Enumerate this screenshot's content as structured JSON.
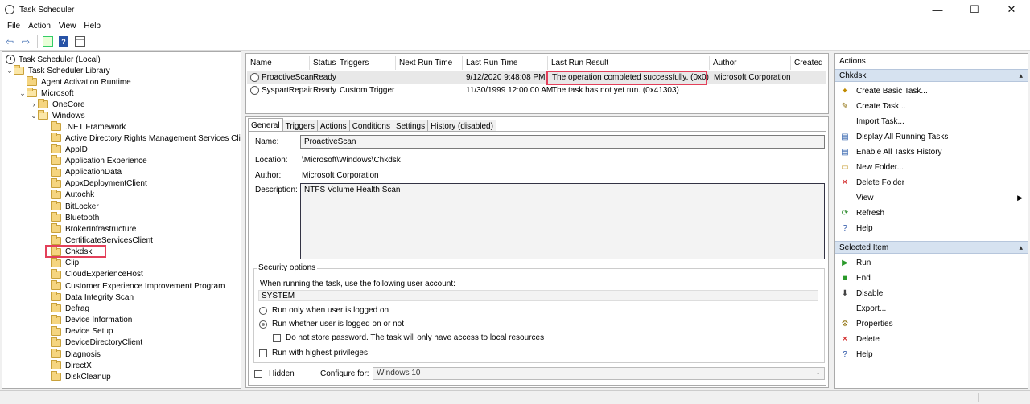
{
  "window": {
    "title": "Task Scheduler",
    "controls": {
      "minimize": "—",
      "maximize": "☐",
      "close": "✕"
    }
  },
  "menu": [
    "File",
    "Action",
    "View",
    "Help"
  ],
  "tree": {
    "root": "Task Scheduler (Local)",
    "library": "Task Scheduler Library",
    "agent": "Agent Activation Runtime",
    "microsoft": "Microsoft",
    "onecore": "OneCore",
    "windows": "Windows",
    "folders": [
      ".NET Framework",
      "Active Directory Rights Management Services Cli",
      "AppID",
      "Application Experience",
      "ApplicationData",
      "AppxDeploymentClient",
      "Autochk",
      "BitLocker",
      "Bluetooth",
      "BrokerInfrastructure",
      "CertificateServicesClient",
      "Chkdsk",
      "Clip",
      "CloudExperienceHost",
      "Customer Experience Improvement Program",
      "Data Integrity Scan",
      "Defrag",
      "Device Information",
      "Device Setup",
      "DeviceDirectoryClient",
      "Diagnosis",
      "DirectX",
      "DiskCleanup"
    ]
  },
  "tasks": {
    "columns": [
      "Name",
      "Status",
      "Triggers",
      "Next Run Time",
      "Last Run Time",
      "Last Run Result",
      "Author",
      "Created"
    ],
    "rows": [
      {
        "name": "ProactiveScan",
        "status": "Ready",
        "triggers": "",
        "next": "",
        "last": "9/12/2020 9:48:08 PM",
        "result": "The operation completed successfully. (0x0)",
        "author": "Microsoft Corporation",
        "created": ""
      },
      {
        "name": "SyspartRepair",
        "status": "Ready",
        "triggers": "Custom Trigger",
        "next": "",
        "last": "11/30/1999 12:00:00 AM",
        "result": "The task has not yet run. (0x41303)",
        "author": "",
        "created": ""
      }
    ]
  },
  "detail": {
    "tabs": [
      "General",
      "Triggers",
      "Actions",
      "Conditions",
      "Settings",
      "History (disabled)"
    ],
    "name_label": "Name:",
    "name_value": "ProactiveScan",
    "location_label": "Location:",
    "location_value": "\\Microsoft\\Windows\\Chkdsk",
    "author_label": "Author:",
    "author_value": "Microsoft Corporation",
    "description_label": "Description:",
    "description_value": "NTFS Volume Health Scan",
    "security_title": "Security options",
    "account_prompt": "When running the task, use the following user account:",
    "account_value": "SYSTEM",
    "opt_logged_on": "Run only when user is logged on",
    "opt_whether": "Run whether user is logged on or not",
    "opt_no_password": "Do not store password.  The task will only have access to local resources",
    "opt_highest": "Run with highest privileges",
    "hidden_label": "Hidden",
    "configure_label": "Configure for:",
    "configure_value": "Windows 10"
  },
  "actions": {
    "header": "Actions",
    "section1": "Chkdsk",
    "items1": [
      "Create Basic Task...",
      "Create Task...",
      "Import Task...",
      "Display All Running Tasks",
      "Enable All Tasks History",
      "New Folder...",
      "Delete Folder",
      "View",
      "Refresh",
      "Help"
    ],
    "section2": "Selected Item",
    "items2": [
      "Run",
      "End",
      "Disable",
      "Export...",
      "Properties",
      "Delete",
      "Help"
    ]
  },
  "colors": {
    "highlight": "#e3405a",
    "section_bg": "#d6e2f0"
  }
}
